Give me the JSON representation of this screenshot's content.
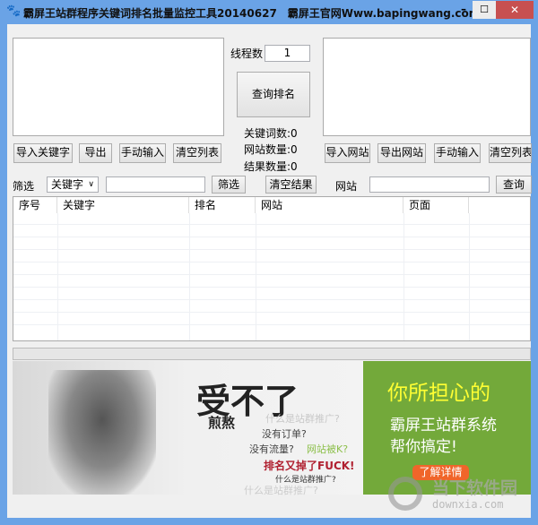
{
  "window": {
    "title": "霸屏王站群程序关键词排名批量监控工具20140627　霸屏王官网Www.bapingwang.com",
    "min": "–",
    "max": "☐",
    "close": "✕"
  },
  "left_panel": {
    "buttons": [
      "导入关键字",
      "导出",
      "手动输入",
      "清空列表"
    ]
  },
  "middle": {
    "thread_label": "线程数",
    "thread_value": "1",
    "query_button": "查询排名",
    "keyword_count": "关键词数:0",
    "site_count": "网站数量:0",
    "result_count": "结果数量:0"
  },
  "right_panel": {
    "buttons": [
      "导入网站",
      "导出网站",
      "手动输入",
      "清空列表"
    ]
  },
  "filter": {
    "label": "筛选",
    "select_value": "关键字",
    "filter_value": "",
    "filter_button": "筛选",
    "clear_button": "清空结果",
    "site_label": "网站",
    "site_value": "",
    "query_button": "查询"
  },
  "table": {
    "columns": [
      "序号",
      "关键字",
      "排名",
      "网站",
      "页面"
    ],
    "rows": []
  },
  "banner": {
    "headline": "受不了",
    "sub": "煎熬",
    "q1": "什么是站群推广?",
    "q2": "没有订单?",
    "q3": "没有流量?",
    "q4": "网站被K?",
    "q5": "排名又掉了FUCK!",
    "q6": "什么是站群推广?",
    "q7": "什么是站群推广?",
    "right_title": "你所担心的",
    "right_line1": "霸屏王站群系统",
    "right_line2": "帮你搞定!",
    "cta": "了解详情",
    "watermark": "当下软件园",
    "watermark_url": "downxia.com"
  }
}
